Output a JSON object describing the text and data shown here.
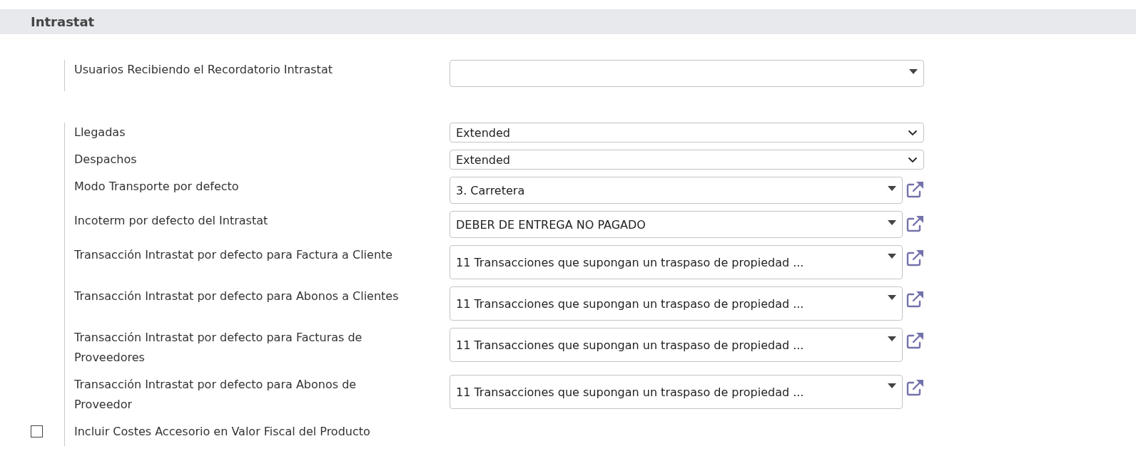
{
  "section": {
    "title": "Intrastat"
  },
  "groups": [
    {
      "fields": [
        {
          "kind": "tags",
          "label": "Usuarios Recibiendo el Recordatorio Intrastat"
        }
      ]
    },
    {
      "fields": [
        {
          "kind": "selection",
          "label": "Llegadas",
          "value": "Extended"
        },
        {
          "kind": "selection",
          "label": "Despachos",
          "value": "Extended"
        },
        {
          "kind": "relation",
          "label": "Modo Transporte por defecto",
          "value": "3. Carretera"
        },
        {
          "kind": "relation",
          "label": "Incoterm por defecto del Intrastat",
          "value": "DEBER DE ENTREGA NO PAGADO"
        },
        {
          "kind": "relation",
          "label": "Transacción Intrastat por defecto para Factura a Cliente",
          "value": "11 Transacciones que supongan un traspaso de propiedad ..."
        },
        {
          "kind": "relation",
          "label": "Transacción Intrastat por defecto para Abonos a Clientes",
          "value": "11 Transacciones que supongan un traspaso de propiedad ..."
        },
        {
          "kind": "relation",
          "label": "Transacción Intrastat por defecto para Facturas de Proveedores",
          "value": "11 Transacciones que supongan un traspaso de propiedad ..."
        },
        {
          "kind": "relation",
          "label": "Transacción Intrastat por defecto para Abonos de Proveedor",
          "value": "11 Transacciones que supongan un traspaso de propiedad ..."
        },
        {
          "kind": "checkbox",
          "label": "Incluir Costes Accesorio en Valor Fiscal del Producto",
          "checked": false
        }
      ]
    }
  ]
}
